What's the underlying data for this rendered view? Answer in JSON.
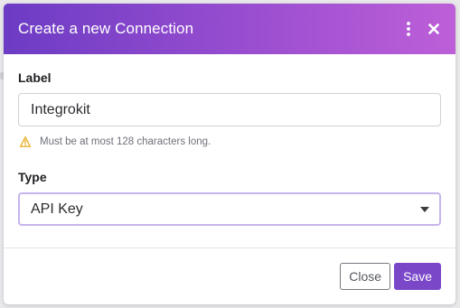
{
  "dialog": {
    "title": "Create a new Connection",
    "menu_icon": "more-vertical-icon",
    "close_icon": "close-icon"
  },
  "label_field": {
    "label": "Label",
    "value": "Integrokit",
    "hint_icon": "warning-icon",
    "hint": "Must be at most 128 characters long."
  },
  "type_field": {
    "label": "Type",
    "selected": "API Key",
    "caret_icon": "caret-down-icon"
  },
  "footer": {
    "close_label": "Close",
    "save_label": "Save"
  },
  "colors": {
    "header_gradient_start": "#6c3cc4",
    "header_gradient_end": "#bd5fd8",
    "save_button": "#7a47c9",
    "select_border": "#c6b5ec",
    "warning_icon": "#e8b12b"
  }
}
